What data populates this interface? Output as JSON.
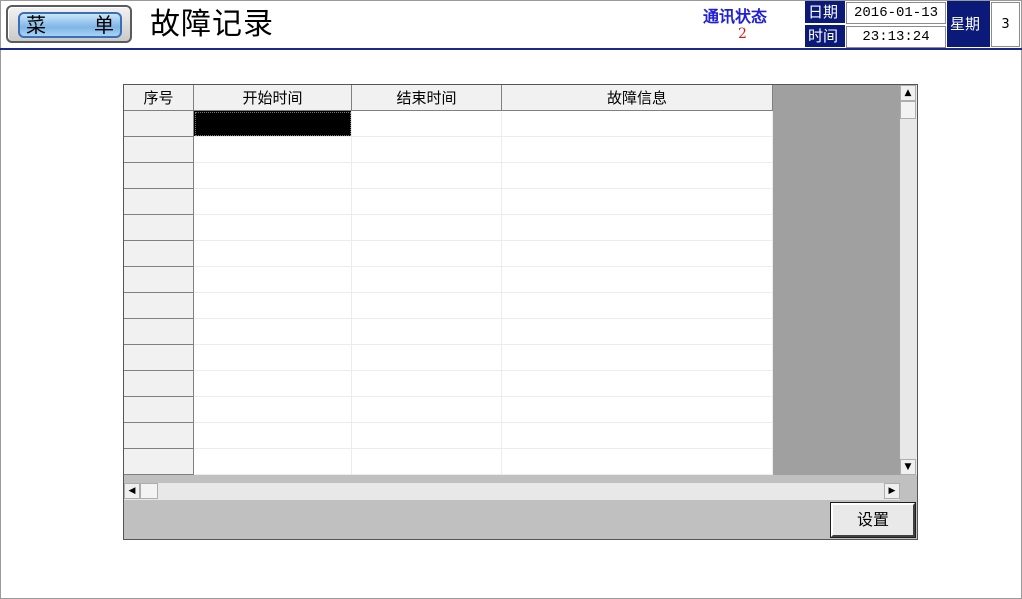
{
  "header": {
    "menu_left": "菜",
    "menu_right": "单",
    "title": "故障记录",
    "comm_label": "通讯状态",
    "comm_value": "2",
    "date_label": "日期",
    "date_value": "2016-01-13",
    "time_label": "时间",
    "time_value": "23:13:24",
    "weekday_label": "星期",
    "weekday_value": "3"
  },
  "table": {
    "columns": [
      "序号",
      "开始时间",
      "结束时间",
      "故障信息"
    ],
    "rows": [
      [
        "",
        "",
        "",
        ""
      ],
      [
        "",
        "",
        "",
        ""
      ],
      [
        "",
        "",
        "",
        ""
      ],
      [
        "",
        "",
        "",
        ""
      ],
      [
        "",
        "",
        "",
        ""
      ],
      [
        "",
        "",
        "",
        ""
      ],
      [
        "",
        "",
        "",
        ""
      ],
      [
        "",
        "",
        "",
        ""
      ],
      [
        "",
        "",
        "",
        ""
      ],
      [
        "",
        "",
        "",
        ""
      ],
      [
        "",
        "",
        "",
        ""
      ],
      [
        "",
        "",
        "",
        ""
      ],
      [
        "",
        "",
        "",
        ""
      ],
      [
        "",
        "",
        "",
        ""
      ]
    ],
    "selected_row": 0,
    "selected_col": 1
  },
  "buttons": {
    "settings_label": "设置"
  },
  "colors": {
    "accent_blue": "#1f1fd8",
    "status_red": "#d21b1b",
    "label_navy": "#0b1a78"
  },
  "icons": {
    "scroll_up": "arrow-up-icon",
    "scroll_down": "arrow-down-icon",
    "scroll_left": "arrow-left-icon",
    "scroll_right": "arrow-right-icon"
  }
}
